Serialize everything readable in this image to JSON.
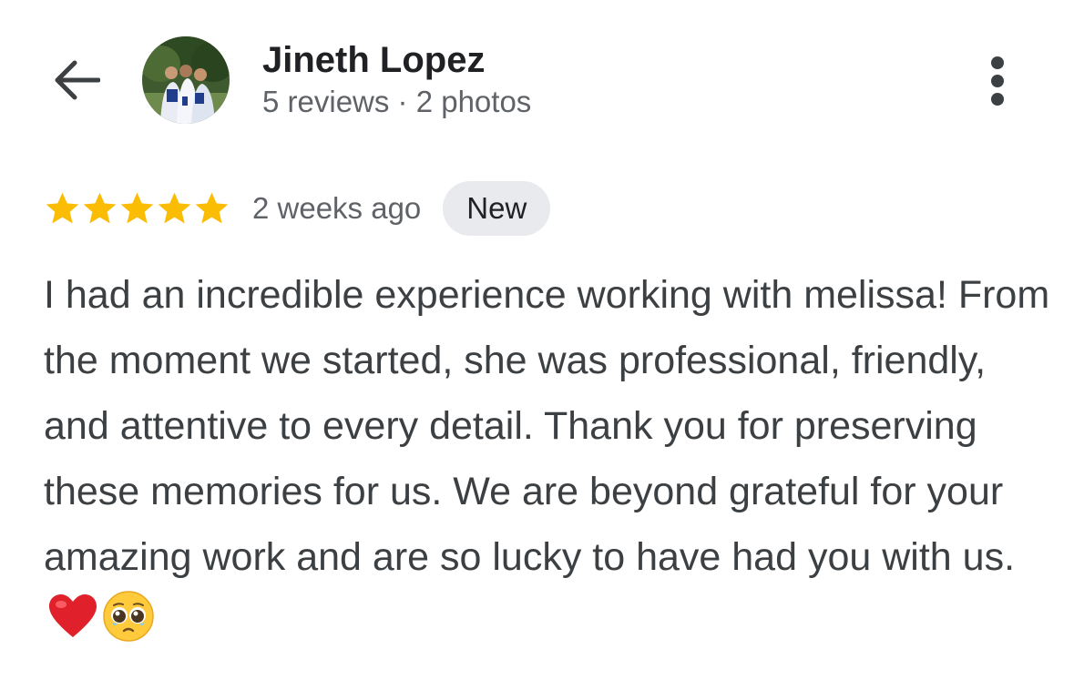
{
  "header": {
    "reviewer_name": "Jineth Lopez",
    "reviewer_meta": "5 reviews · 2 photos",
    "back_icon": "arrow-back-icon",
    "more_icon": "more-vert-icon"
  },
  "review": {
    "rating": 5,
    "max_rating": 5,
    "time_ago": "2 weeks ago",
    "badge": "New",
    "text": "I had an incredible experience working with melissa! From the moment we started, she was professional, friendly, and attentive to every detail. Thank you for preserving these memories for us. We are beyond grateful for your amazing work and are so lucky to have had you with us.",
    "emojis": [
      "❤️",
      "🥹"
    ]
  },
  "colors": {
    "star": "#fbbc04",
    "name": "#202124",
    "secondary_text": "#5f6368",
    "body_text": "#3c4043",
    "badge_bg": "#e8eaed",
    "heart": "#e0212b"
  }
}
